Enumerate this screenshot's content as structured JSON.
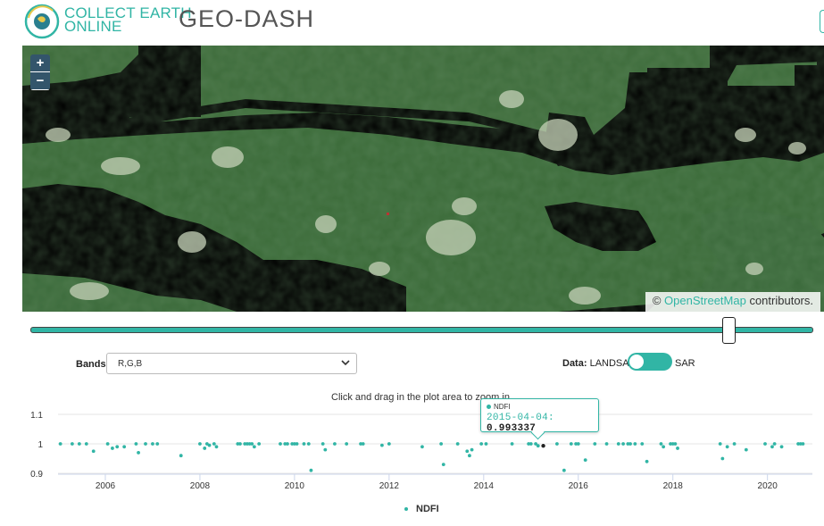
{
  "header": {
    "brand_line1": "COLLECT EARTH",
    "brand_line2": "ONLINE",
    "app_name": "GEO-DASH",
    "logo_icon": "collect-earth-globe-icon",
    "accent_color": "#31b5a5"
  },
  "map": {
    "zoom_in_label": "+",
    "zoom_out_label": "−",
    "attribution_prefix": "©",
    "attribution_link": "OpenStreetMap",
    "attribution_suffix": "contributors."
  },
  "time_slider": {
    "position_fraction": 0.9
  },
  "controls": {
    "bands_label": "Bands:",
    "bands_value": "R,G,B",
    "data_label": "Data:",
    "data_option_left": "LANDSAT",
    "data_option_right": "SAR",
    "toggle_state": "LANDSAT"
  },
  "plot": {
    "hint": "Click and drag in the plot area to zoom in",
    "tooltip_series": "NDFI",
    "tooltip_date": "2015-04-04:",
    "tooltip_value": "0.993337",
    "legend_label": "NDFI"
  },
  "chart_data": {
    "type": "scatter",
    "series": [
      {
        "name": "NDFI",
        "color": "#31b5a5",
        "x": [
          2005.05,
          2005.3,
          2005.45,
          2005.6,
          2005.75,
          2006.05,
          2006.15,
          2006.25,
          2006.4,
          2006.65,
          2006.7,
          2006.85,
          2007.0,
          2007.1,
          2007.6,
          2008.0,
          2008.1,
          2008.15,
          2008.2,
          2008.3,
          2008.35,
          2008.8,
          2008.85,
          2008.95,
          2009.0,
          2009.05,
          2009.1,
          2009.15,
          2009.25,
          2009.7,
          2009.8,
          2009.85,
          2009.95,
          2010.0,
          2010.05,
          2010.2,
          2010.3,
          2010.35,
          2010.6,
          2010.65,
          2010.85,
          2011.1,
          2011.4,
          2011.45,
          2011.85,
          2012.0,
          2012.7,
          2013.1,
          2013.15,
          2013.45,
          2013.65,
          2013.7,
          2013.75,
          2013.95,
          2014.05,
          2014.6,
          2014.95,
          2015.0,
          2015.1,
          2015.15,
          2015.26,
          2015.55,
          2015.7,
          2015.85,
          2015.95,
          2016.0,
          2016.15,
          2016.35,
          2016.6,
          2016.85,
          2016.95,
          2017.05,
          2017.1,
          2017.2,
          2017.35,
          2017.45,
          2017.75,
          2017.8,
          2017.95,
          2018.0,
          2018.05,
          2018.1,
          2019.0,
          2019.05,
          2019.15,
          2019.3,
          2019.55,
          2019.95,
          2020.1,
          2020.15,
          2020.3,
          2020.65,
          2020.7,
          2020.75
        ],
        "y": [
          1.0,
          1.0,
          1.0,
          1.0,
          0.975,
          1.0,
          0.985,
          0.99,
          0.99,
          1.0,
          0.97,
          1.0,
          1.0,
          1.0,
          0.96,
          1.0,
          0.985,
          1.0,
          0.995,
          1.0,
          0.99,
          1.0,
          1.0,
          1.0,
          1.0,
          1.0,
          1.0,
          0.99,
          1.0,
          1.0,
          1.0,
          1.0,
          1.0,
          1.0,
          1.0,
          1.0,
          1.0,
          0.91,
          1.0,
          0.98,
          1.0,
          1.0,
          1.0,
          1.0,
          0.995,
          1.0,
          0.99,
          1.0,
          0.93,
          1.0,
          0.975,
          0.96,
          0.98,
          1.0,
          1.0,
          1.0,
          1.0,
          1.0,
          1.0,
          0.993337,
          0.993337,
          1.0,
          0.91,
          1.0,
          1.0,
          1.0,
          0.945,
          1.0,
          1.0,
          1.0,
          1.0,
          1.0,
          1.0,
          1.0,
          1.0,
          0.94,
          1.0,
          0.99,
          1.0,
          1.0,
          1.0,
          0.985,
          1.0,
          0.95,
          0.99,
          1.0,
          0.98,
          1.0,
          0.99,
          1.0,
          0.99,
          1.0,
          1.0,
          1.0
        ]
      }
    ],
    "highlight": {
      "x": 2015.26,
      "y": 0.993337,
      "label": "2015-04-04"
    },
    "xlim": [
      2005.0,
      2020.95
    ],
    "ylim": [
      0.9,
      1.1
    ],
    "xticks": [
      "2006",
      "2008",
      "2010",
      "2012",
      "2014",
      "2016",
      "2018",
      "2020"
    ],
    "yticks": [
      "0.9",
      "1",
      "1.1"
    ],
    "legend": "bottom-center",
    "grid": true
  }
}
